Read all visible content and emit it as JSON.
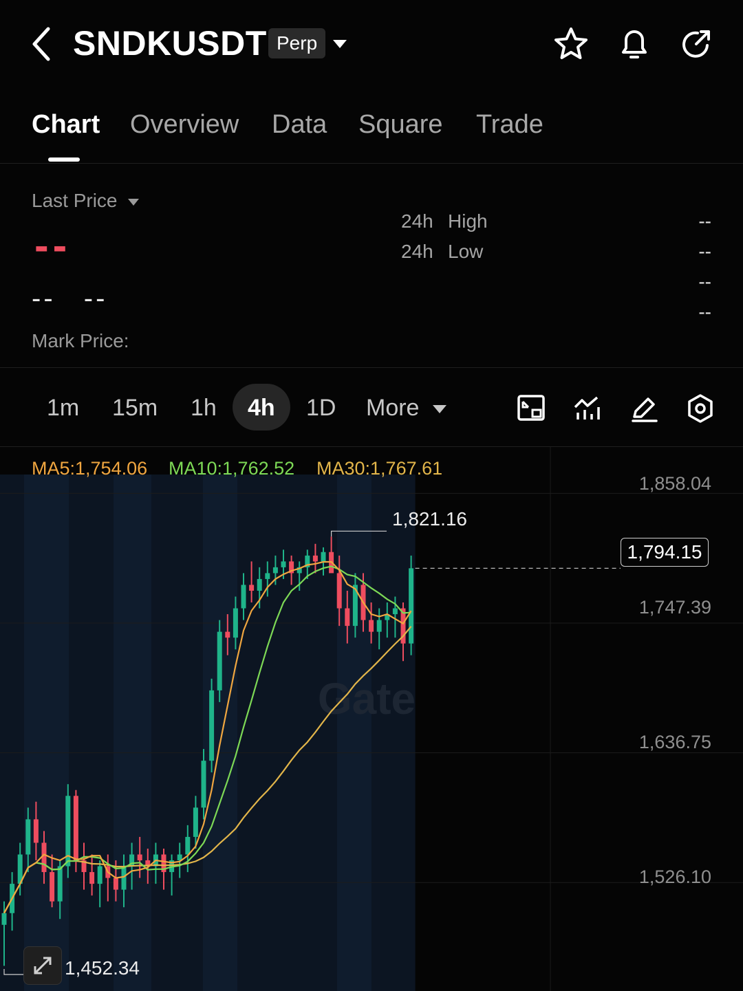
{
  "header": {
    "symbol": "SNDKUSDT",
    "badge": "Perp"
  },
  "tabs": [
    {
      "label": "Chart",
      "active": true
    },
    {
      "label": "Overview",
      "active": false
    },
    {
      "label": "Data",
      "active": false
    },
    {
      "label": "Square",
      "active": false
    },
    {
      "label": "Trade",
      "active": false
    }
  ],
  "price_info": {
    "last_price_label": "Last Price",
    "last_price_value": "--",
    "change_value": "--",
    "change_percent": "--",
    "mark_price_label": "Mark Price:",
    "high_prefix": "24h",
    "high_label": "High",
    "high_value": "--",
    "low_prefix": "24h",
    "low_label": "Low",
    "low_value": "--",
    "extra_value_1": "--",
    "extra_value_2": "--"
  },
  "timeframes": {
    "items": [
      "1m",
      "15m",
      "1h",
      "4h",
      "1D"
    ],
    "active": "4h",
    "more_label": "More"
  },
  "chart_data": {
    "type": "candlestick",
    "ma_labels": {
      "ma5": "MA5:1,754.06",
      "ma10": "MA10:1,762.52",
      "ma30": "MA30:1,767.61"
    },
    "colors": {
      "up": "#1fb48a",
      "down": "#ef4d5f",
      "ma5": "#f0a640",
      "ma10": "#7dd956",
      "ma30": "#e2b54a"
    },
    "y_ticks": [
      "1,858.04",
      "1,747.39",
      "1,636.75",
      "1,526.10"
    ],
    "y_tick_values": [
      1858.04,
      1747.39,
      1636.75,
      1526.1
    ],
    "ylim": [
      1440,
      1880
    ],
    "current_price": "1,794.15",
    "current_price_value": 1794.15,
    "max_label": "1,821.16",
    "max_value": 1821.16,
    "min_label": "1,452.34",
    "min_value": 1452.34,
    "watermark": "Gate",
    "candles": [
      [
        1490,
        1510,
        1455,
        1500
      ],
      [
        1500,
        1535,
        1485,
        1525
      ],
      [
        1525,
        1560,
        1515,
        1550
      ],
      [
        1550,
        1590,
        1535,
        1580
      ],
      [
        1580,
        1595,
        1545,
        1560
      ],
      [
        1560,
        1570,
        1525,
        1535
      ],
      [
        1535,
        1550,
        1505,
        1510
      ],
      [
        1510,
        1545,
        1495,
        1540
      ],
      [
        1540,
        1610,
        1530,
        1600
      ],
      [
        1600,
        1605,
        1535,
        1545
      ],
      [
        1545,
        1560,
        1520,
        1535
      ],
      [
        1535,
        1550,
        1515,
        1525
      ],
      [
        1525,
        1545,
        1505,
        1540
      ],
      [
        1540,
        1550,
        1510,
        1530
      ],
      [
        1530,
        1545,
        1510,
        1520
      ],
      [
        1520,
        1550,
        1505,
        1540
      ],
      [
        1540,
        1560,
        1520,
        1550
      ],
      [
        1550,
        1565,
        1530,
        1545
      ],
      [
        1545,
        1555,
        1525,
        1540
      ],
      [
        1540,
        1560,
        1525,
        1550
      ],
      [
        1550,
        1555,
        1520,
        1535
      ],
      [
        1535,
        1550,
        1515,
        1545
      ],
      [
        1545,
        1560,
        1530,
        1550
      ],
      [
        1550,
        1575,
        1535,
        1565
      ],
      [
        1565,
        1600,
        1555,
        1590
      ],
      [
        1590,
        1640,
        1580,
        1630
      ],
      [
        1630,
        1700,
        1620,
        1690
      ],
      [
        1690,
        1750,
        1680,
        1740
      ],
      [
        1740,
        1755,
        1720,
        1735
      ],
      [
        1735,
        1770,
        1725,
        1760
      ],
      [
        1760,
        1790,
        1750,
        1780
      ],
      [
        1780,
        1800,
        1765,
        1775
      ],
      [
        1775,
        1795,
        1760,
        1785
      ],
      [
        1785,
        1800,
        1770,
        1790
      ],
      [
        1790,
        1805,
        1780,
        1795
      ],
      [
        1795,
        1810,
        1785,
        1800
      ],
      [
        1800,
        1805,
        1780,
        1790
      ],
      [
        1790,
        1800,
        1775,
        1795
      ],
      [
        1795,
        1810,
        1785,
        1805
      ],
      [
        1805,
        1815,
        1790,
        1800
      ],
      [
        1800,
        1812,
        1788,
        1808
      ],
      [
        1808,
        1821.16,
        1795,
        1790
      ],
      [
        1790,
        1805,
        1745,
        1760
      ],
      [
        1760,
        1775,
        1730,
        1745
      ],
      [
        1745,
        1790,
        1735,
        1780
      ],
      [
        1780,
        1790,
        1740,
        1750
      ],
      [
        1750,
        1765,
        1730,
        1740
      ],
      [
        1740,
        1760,
        1725,
        1750
      ],
      [
        1750,
        1765,
        1735,
        1755
      ],
      [
        1755,
        1770,
        1735,
        1760
      ],
      [
        1760,
        1765,
        1715,
        1730
      ],
      [
        1730,
        1805,
        1720,
        1794.15
      ]
    ]
  }
}
